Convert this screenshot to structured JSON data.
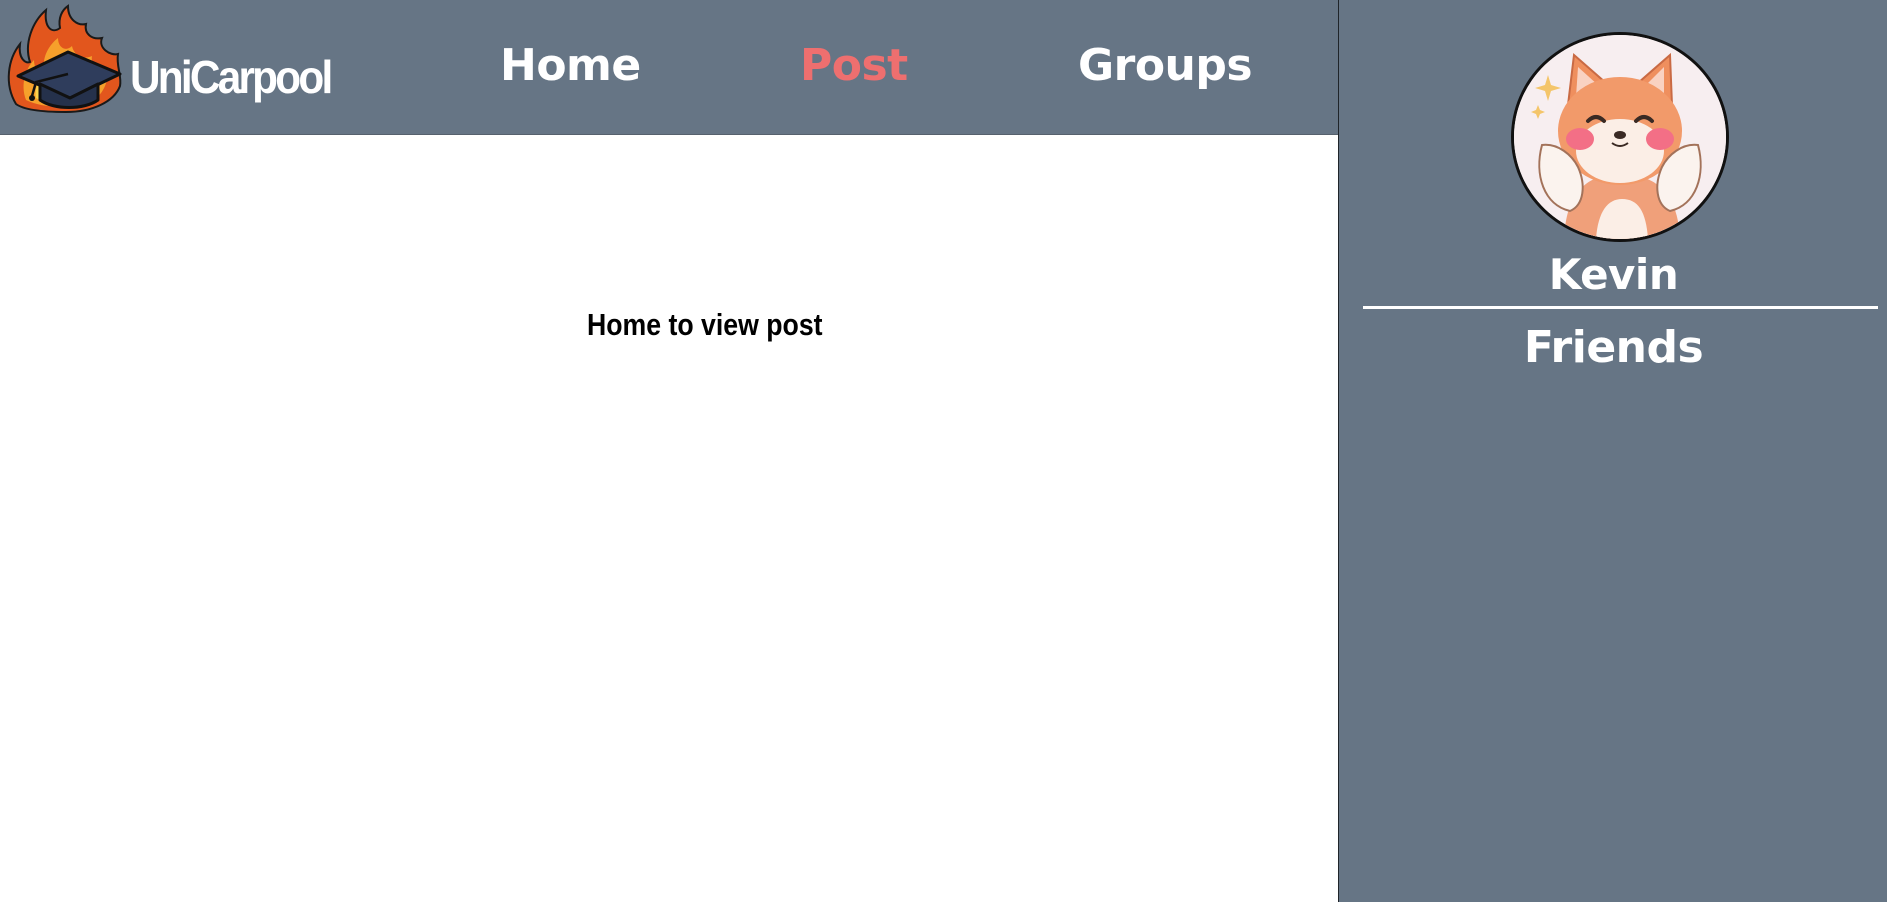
{
  "header": {
    "brand": "UniCarpool",
    "logo_icon": "flaming-graduation-cap-icon",
    "nav": {
      "home": "Home",
      "post": "Post",
      "groups": "Groups"
    },
    "active_nav": "Post"
  },
  "main": {
    "message": "Home to view post"
  },
  "sidebar": {
    "avatar_icon": "shiba-dog-avatar",
    "username": "Kevin",
    "friends_heading": "Friends"
  },
  "colors": {
    "panel": "#667585",
    "active_link": "#ee6f6f",
    "text_light": "#ffffff",
    "content_bg": "#ffffff"
  }
}
